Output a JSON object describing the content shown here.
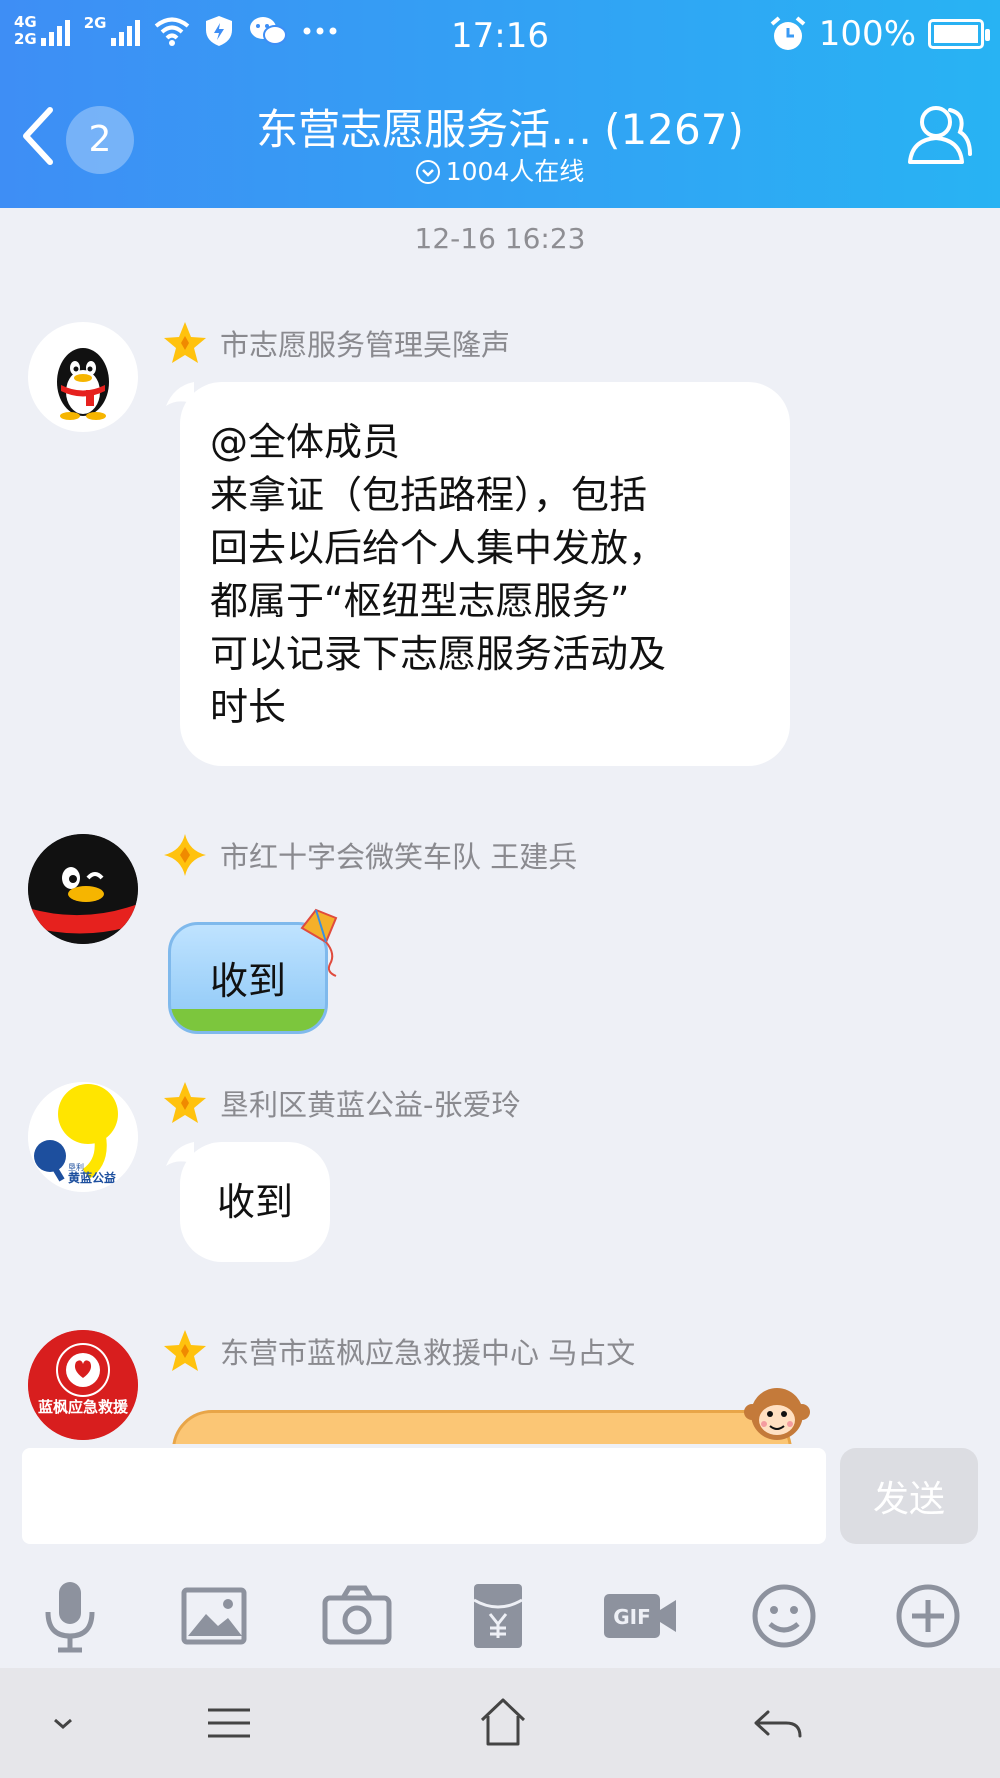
{
  "status_bar": {
    "network_1": "4G",
    "network_2": "2G",
    "network_3": "2G",
    "time": "17:16",
    "battery": "100%",
    "battery_level": 1.0
  },
  "header": {
    "back_count": "2",
    "title": "东营志愿服务活…",
    "member_count": "(1267)",
    "online": "1004人在线"
  },
  "chat": {
    "timestamp": "12-16 16:23",
    "messages": [
      {
        "sender": "市志愿服务管理吴隆声",
        "text": "@全体成员\n来拿证（包括路程），包括\n回去以后给个人集中发放，\n都属于“枢纽型志愿服务”\n可以记录下志愿服务活动及\n时长"
      },
      {
        "sender": "市红十字会微笑车队 王建兵",
        "text": "收到"
      },
      {
        "sender": "垦利区黄蓝公益-张爱玲",
        "text": "收到",
        "avatar_text": "黄蓝公益",
        "avatar_small": "垦利"
      },
      {
        "sender": "东营市蓝枫应急救援中心 马占文",
        "text": "",
        "avatar_text": "蓝枫应急救援"
      }
    ]
  },
  "composer": {
    "input_value": "",
    "send_label": "发送",
    "tools": [
      "microphone-icon",
      "image-icon",
      "camera-icon",
      "red-packet-icon",
      "gif-icon",
      "emoji-icon",
      "plus-icon"
    ]
  },
  "colors": {
    "header_start": "#3e8ef5",
    "header_end": "#28b3f3",
    "background": "#eef0f6",
    "sender_text": "#8a8a8f",
    "star": "#ffc20e"
  }
}
